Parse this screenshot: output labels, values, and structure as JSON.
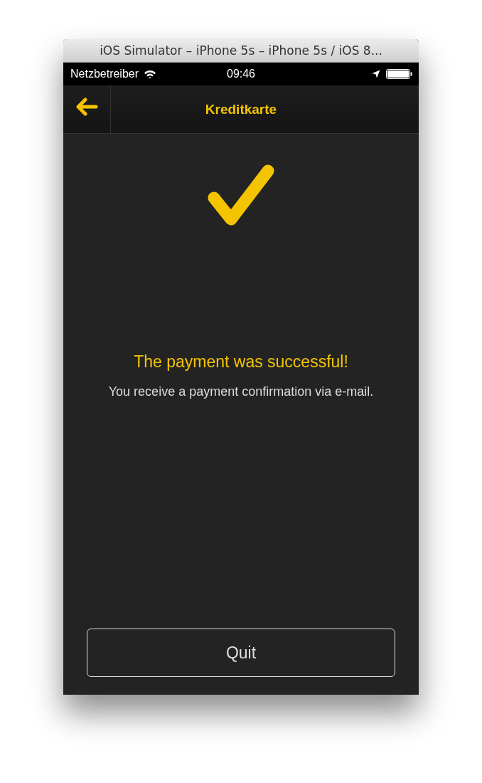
{
  "window": {
    "title": "iOS Simulator – iPhone 5s – iPhone 5s / iOS 8..."
  },
  "status_bar": {
    "carrier": "Netzbetreiber",
    "time": "09:46"
  },
  "nav_bar": {
    "title": "Kreditkarte"
  },
  "message": {
    "heading": "The payment was successful!",
    "body": "You receive a payment confirmation via e-mail."
  },
  "buttons": [
    "Quit"
  ]
}
